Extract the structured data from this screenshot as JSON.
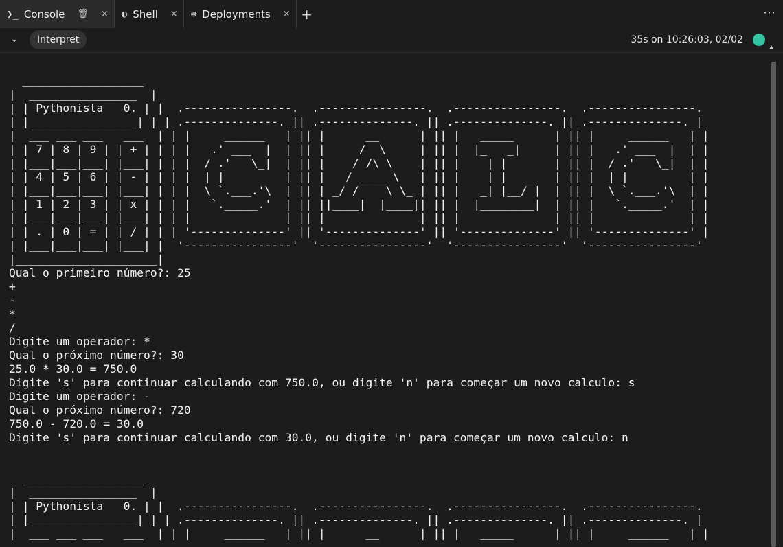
{
  "tabs": [
    {
      "name": "tab-console",
      "icon": "terminal-icon",
      "glyph": "❯_",
      "label": "Console",
      "active": true
    },
    {
      "name": "tab-shell",
      "icon": "shell-icon",
      "glyph": "◐",
      "label": "Shell",
      "active": false
    },
    {
      "name": "tab-deployments",
      "icon": "deployments-icon",
      "glyph": "⊛",
      "label": "Deployments",
      "active": false
    }
  ],
  "tabbar": {
    "add_label": "+",
    "menu_label": "⋯",
    "close_glyph": "×",
    "trash_glyph": "🗑"
  },
  "toolbar": {
    "collapse_glyph": "⌄",
    "interpret_label": "Interpret",
    "status": "35s on 10:26:03, 02/02",
    "status_color": "#35c4a3"
  },
  "console": {
    "lines": [
      "  __________________",
      "|  ________________  |",
      "| | Pythonista   0. | |  .----------------.  .----------------.  .----------------.  .----------------.",
      "| |________________| | | .--------------. || .--------------. || .--------------. || .--------------. |",
      "|  ___ ___ ___   ___  | | |     ______   | || |      __      | || |   _____      | || |     ______   | |",
      "| | 7 | 8 | 9 | | + | | | |   .' ___  |  | || |     /  \\     | || |  |_   _|     | || |   .' ___  |  | |",
      "| |___|___|___| |___| | | |  / .'   \\_|  | || |    / /\\ \\    | || |    | |       | || |  / .'   \\_|  | |",
      "| | 4 | 5 | 6 | | - | | | |  | |         | || |   / ____ \\   | || |    | |   _   | || |  | |         | |",
      "| |___|___|___| |___| | | |  \\ `.___.'\\  | || | _/ /    \\ \\_ | || |   _| |__/ |  | || |  \\ `.___.'\\  | |",
      "| | 1 | 2 | 3 | | x | | | |   `._____.'  | || ||____|  |____|| || |  |________|  | || |   `._____.'  | |",
      "| |___|___|___| |___| | | |              | || |              | || |              | || |              | |",
      "| | . | 0 | = | | / | | | '--------------' || '--------------' || '--------------' || '--------------' |",
      "| |___|___|___| |___| |  '----------------'  '----------------'  '----------------'  '----------------'",
      "|_____________________|",
      "Qual o primeiro número?: 25",
      "+",
      "-",
      "*",
      "/",
      "Digite um operador: *",
      "Qual o próximo número?: 30",
      "25.0 * 30.0 = 750.0",
      "Digite 's' para continuar calculando com 750.0, ou digite 'n' para começar um novo calculo: s",
      "Digite um operador: -",
      "Qual o próximo número?: 720",
      "750.0 - 720.0 = 30.0",
      "Digite 's' para continuar calculando com 30.0, ou digite 'n' para começar um novo calculo: n",
      "",
      "",
      "  __________________",
      "|  ________________  |",
      "| | Pythonista   0. | |  .----------------.  .----------------.  .----------------.  .----------------.",
      "| |________________| | | .--------------. || .--------------. || .--------------. || .--------------. |",
      "|  ___ ___ ___   ___  | | |     ______   | || |      __      | || |   _____      | || |     ______   | |"
    ]
  }
}
